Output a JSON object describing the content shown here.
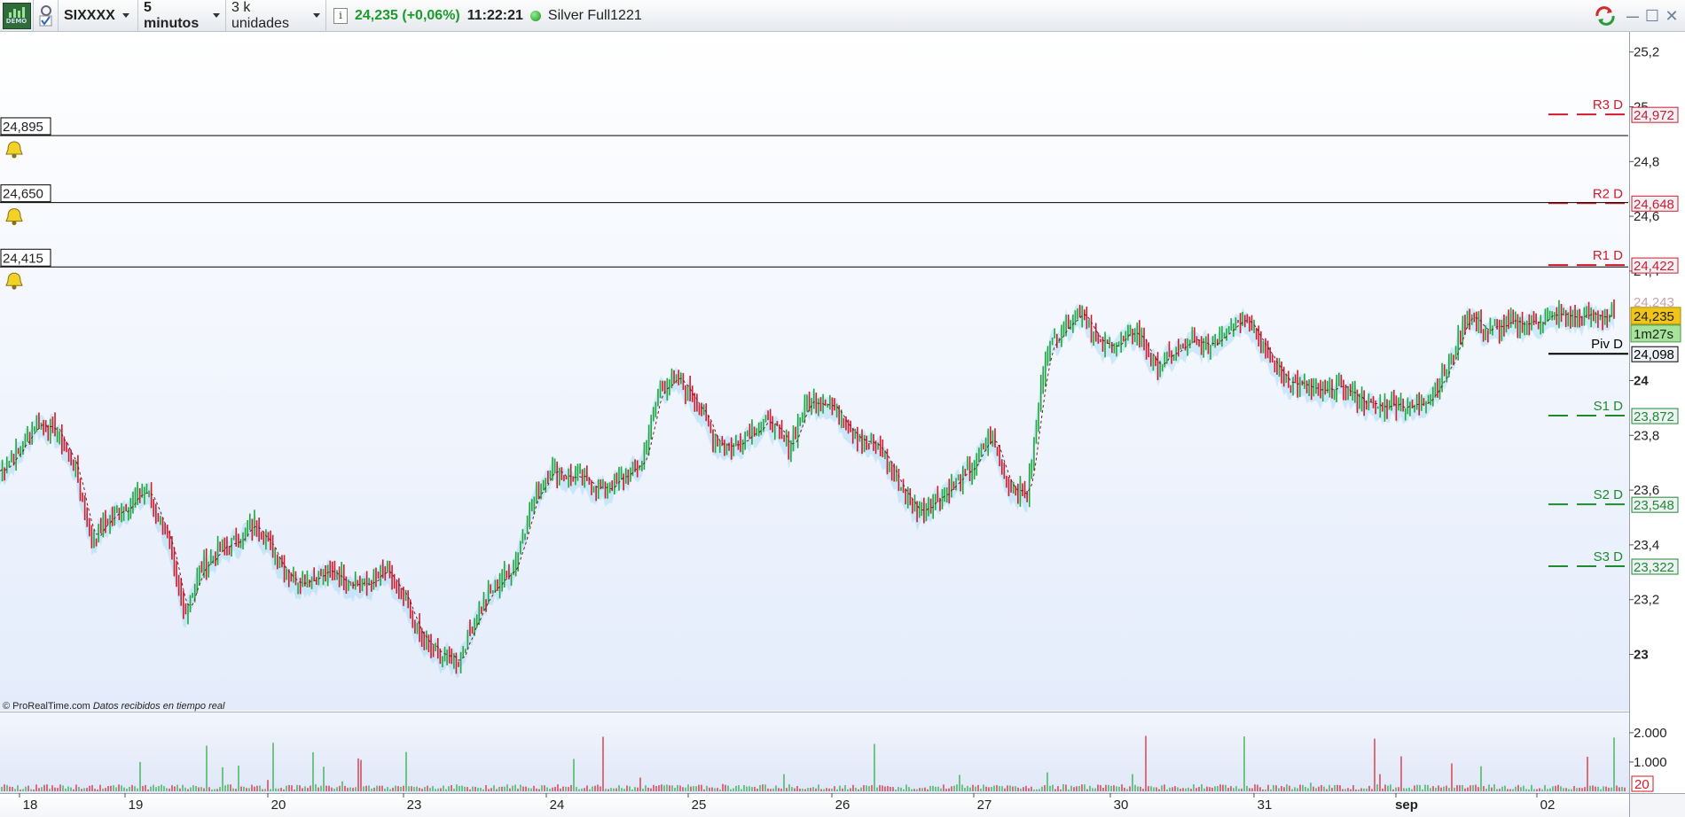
{
  "toolbar": {
    "logo_label": "DEMO",
    "symbol": "SIXXXX",
    "timeframe": "5 minutos",
    "units": "3 k unidades",
    "quote": "24,235 (+0,06%)",
    "clock": "11:22:21",
    "instrument_name": "Silver Full1221",
    "info_icon": "i"
  },
  "window_controls": {
    "minimize": "—",
    "restore": "☐",
    "close": "✕"
  },
  "colors": {
    "up": "#22a83a",
    "down": "#d21a2a",
    "resistance": "#d21a2a",
    "support": "#1e8a2e",
    "pivot": "#000000",
    "last_price_bg": "#f0c419",
    "timer_bg": "#a6e39b"
  },
  "alerts": [
    {
      "label": "24,895",
      "price": 24.895
    },
    {
      "label": "24,650",
      "price": 24.65
    },
    {
      "label": "24,415",
      "price": 24.415
    }
  ],
  "pivot_levels": [
    {
      "name": "R3 D",
      "label": "24,972",
      "value": 24.972,
      "kind": "resistance"
    },
    {
      "name": "R2 D",
      "label": "24,648",
      "value": 24.648,
      "kind": "resistance"
    },
    {
      "name": "R1 D",
      "label": "24,422",
      "value": 24.422,
      "kind": "resistance"
    },
    {
      "name": "Piv D",
      "label": "24,098",
      "value": 24.098,
      "kind": "pivot"
    },
    {
      "name": "S1 D",
      "label": "23,872",
      "value": 23.872,
      "kind": "support"
    },
    {
      "name": "S2 D",
      "label": "23,548",
      "value": 23.548,
      "kind": "support"
    },
    {
      "name": "S3 D",
      "label": "23,322",
      "value": 23.322,
      "kind": "support"
    }
  ],
  "price_badges": {
    "last": "24,235",
    "timer": "1m27s",
    "hidden_partial": "24,243"
  },
  "copyright": {
    "brand": "© ProRealTime.com",
    "note": "Datos recibidos en tiempo real"
  },
  "chart_data": {
    "type": "line",
    "y_ticks": [
      "25,2",
      "25",
      "24,8",
      "24,6",
      "24,4",
      "24",
      "23,8",
      "23,6",
      "23,4",
      "23,2",
      "23"
    ],
    "ylim": [
      22.85,
      25.28
    ],
    "x_labels": [
      "18",
      "19",
      "20",
      "23",
      "24",
      "25",
      "26",
      "27",
      "30",
      "31",
      "sep",
      "02"
    ],
    "series": [
      {
        "values": [
          23.67,
          23.74,
          23.85,
          23.82,
          23.7,
          23.42,
          23.5,
          23.55,
          23.6,
          23.45,
          23.15,
          23.32,
          23.38,
          23.42,
          23.48,
          23.36,
          23.27,
          23.28,
          23.3,
          23.27,
          23.25,
          23.3,
          23.2,
          23.05,
          23.0,
          22.98,
          23.15,
          23.25,
          23.32,
          23.55,
          23.68,
          23.65,
          23.63,
          23.6,
          23.65,
          23.7,
          23.98,
          24.0,
          23.92,
          23.78,
          23.76,
          23.82,
          23.85,
          23.75,
          23.92,
          23.93,
          23.86,
          23.78,
          23.75,
          23.62,
          23.52,
          23.57,
          23.62,
          23.68,
          23.8,
          23.62,
          23.58,
          24.1,
          24.2,
          24.26,
          24.12,
          24.14,
          24.18,
          24.05,
          24.1,
          24.14,
          24.13,
          24.2,
          24.24,
          24.1,
          24.01,
          23.98,
          23.95,
          23.98,
          23.94,
          23.9,
          23.92,
          23.9,
          23.95,
          24.05,
          24.25,
          24.18,
          24.2,
          24.21,
          24.22,
          24.24,
          24.23,
          24.24,
          24.235
        ]
      }
    ],
    "volume": {
      "y_ticks": [
        "2.000",
        "1.000"
      ],
      "ylim": [
        0,
        2600
      ],
      "period_label": "20"
    },
    "legend": "none",
    "grid": false
  }
}
